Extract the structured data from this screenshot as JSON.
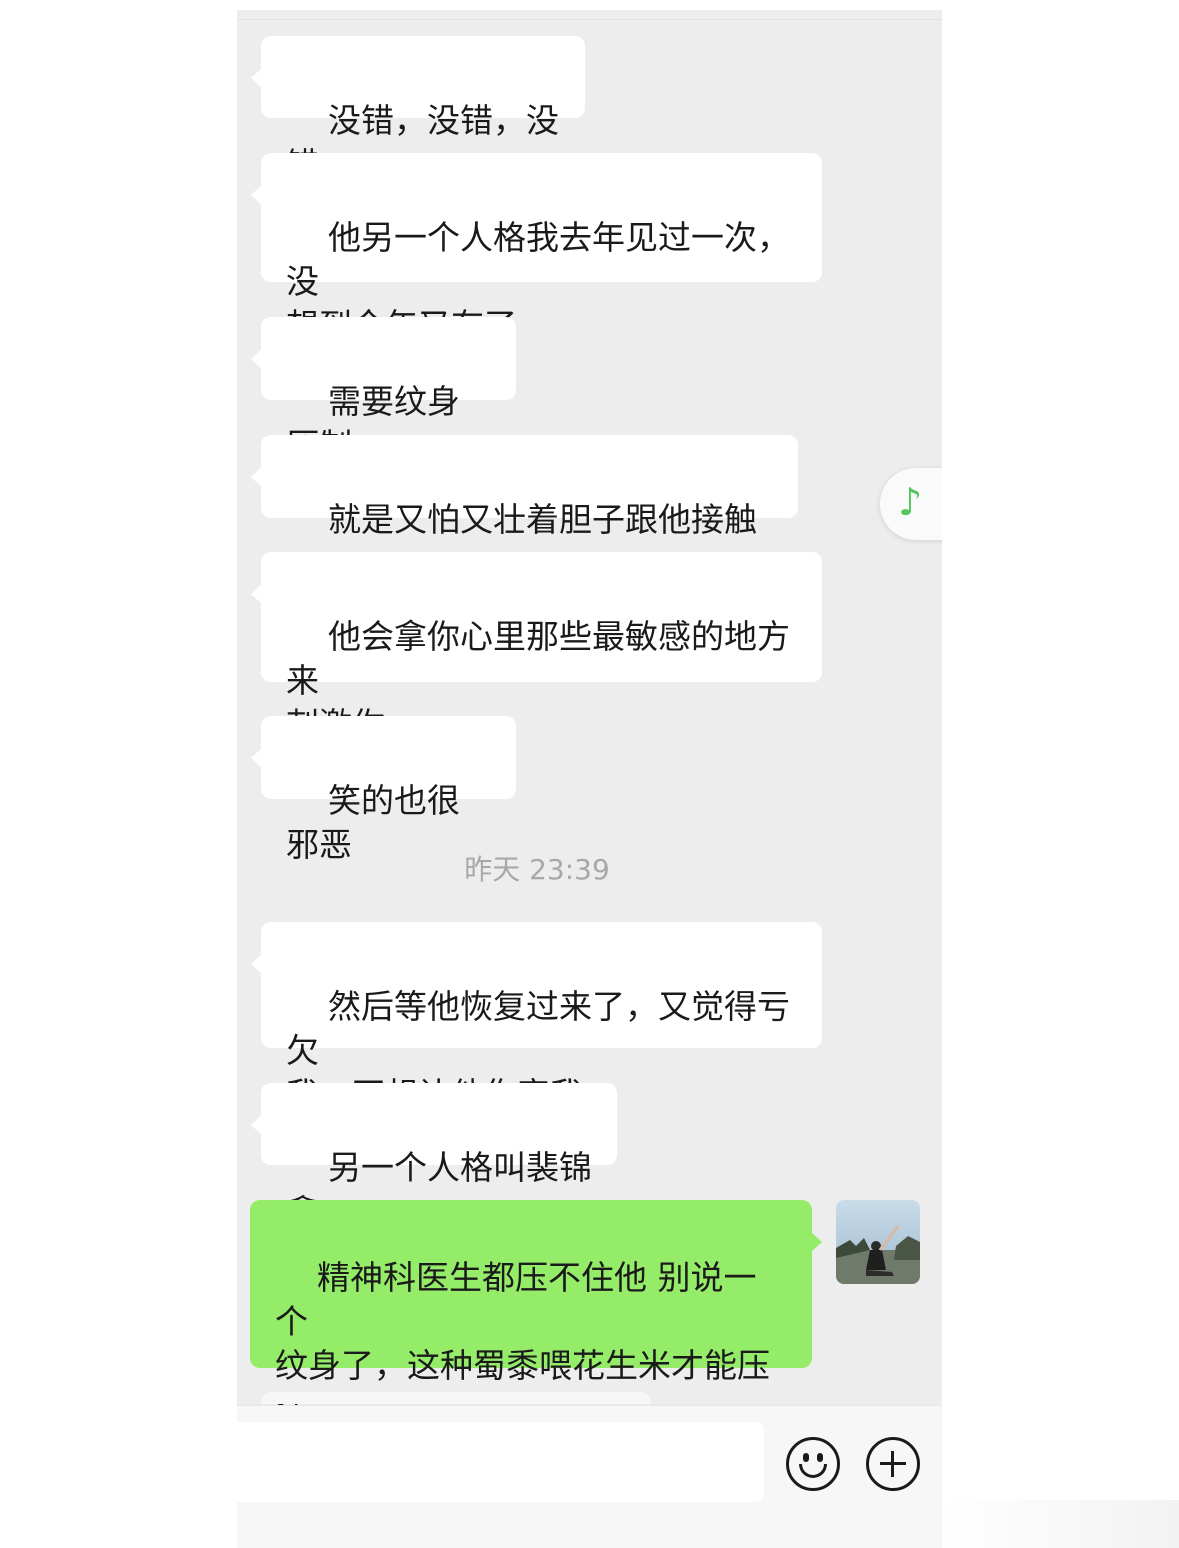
{
  "messages": [
    {
      "side": "left",
      "text": "没错，没错，没错"
    },
    {
      "side": "left",
      "text": "他另一个人格我去年见过一次，没\n想到今年又有了"
    },
    {
      "side": "left",
      "text": "需要纹身压制"
    },
    {
      "side": "left",
      "text": "就是又怕又壮着胆子跟他接触"
    },
    {
      "side": "left",
      "text": "他会拿你心里那些最敏感的地方来\n刺激你"
    },
    {
      "side": "left",
      "text": "笑的也很邪恶"
    },
    {
      "side": "left",
      "text": "然后等他恢复过来了，又觉得亏欠\n我，不想让他伤害我"
    },
    {
      "side": "left",
      "text": "另一个人格叫裴锦鑫"
    },
    {
      "side": "right",
      "text": "精神科医生都压不住他 别说一个\n纹身了，这种蜀黍喂花生米才能压\n住"
    }
  ],
  "timestamp": "昨天 23:39",
  "music_icon": "♪",
  "input": {
    "placeholder": ""
  },
  "icons": {
    "emoji": "emoji-icon",
    "plus": "plus-icon",
    "music": "music-note-icon",
    "crying": "crying-face-emoji"
  },
  "colors": {
    "chat_bg": "#ededed",
    "bubble_left": "#ffffff",
    "bubble_right": "#95ec69",
    "music_green": "#56c35b"
  }
}
